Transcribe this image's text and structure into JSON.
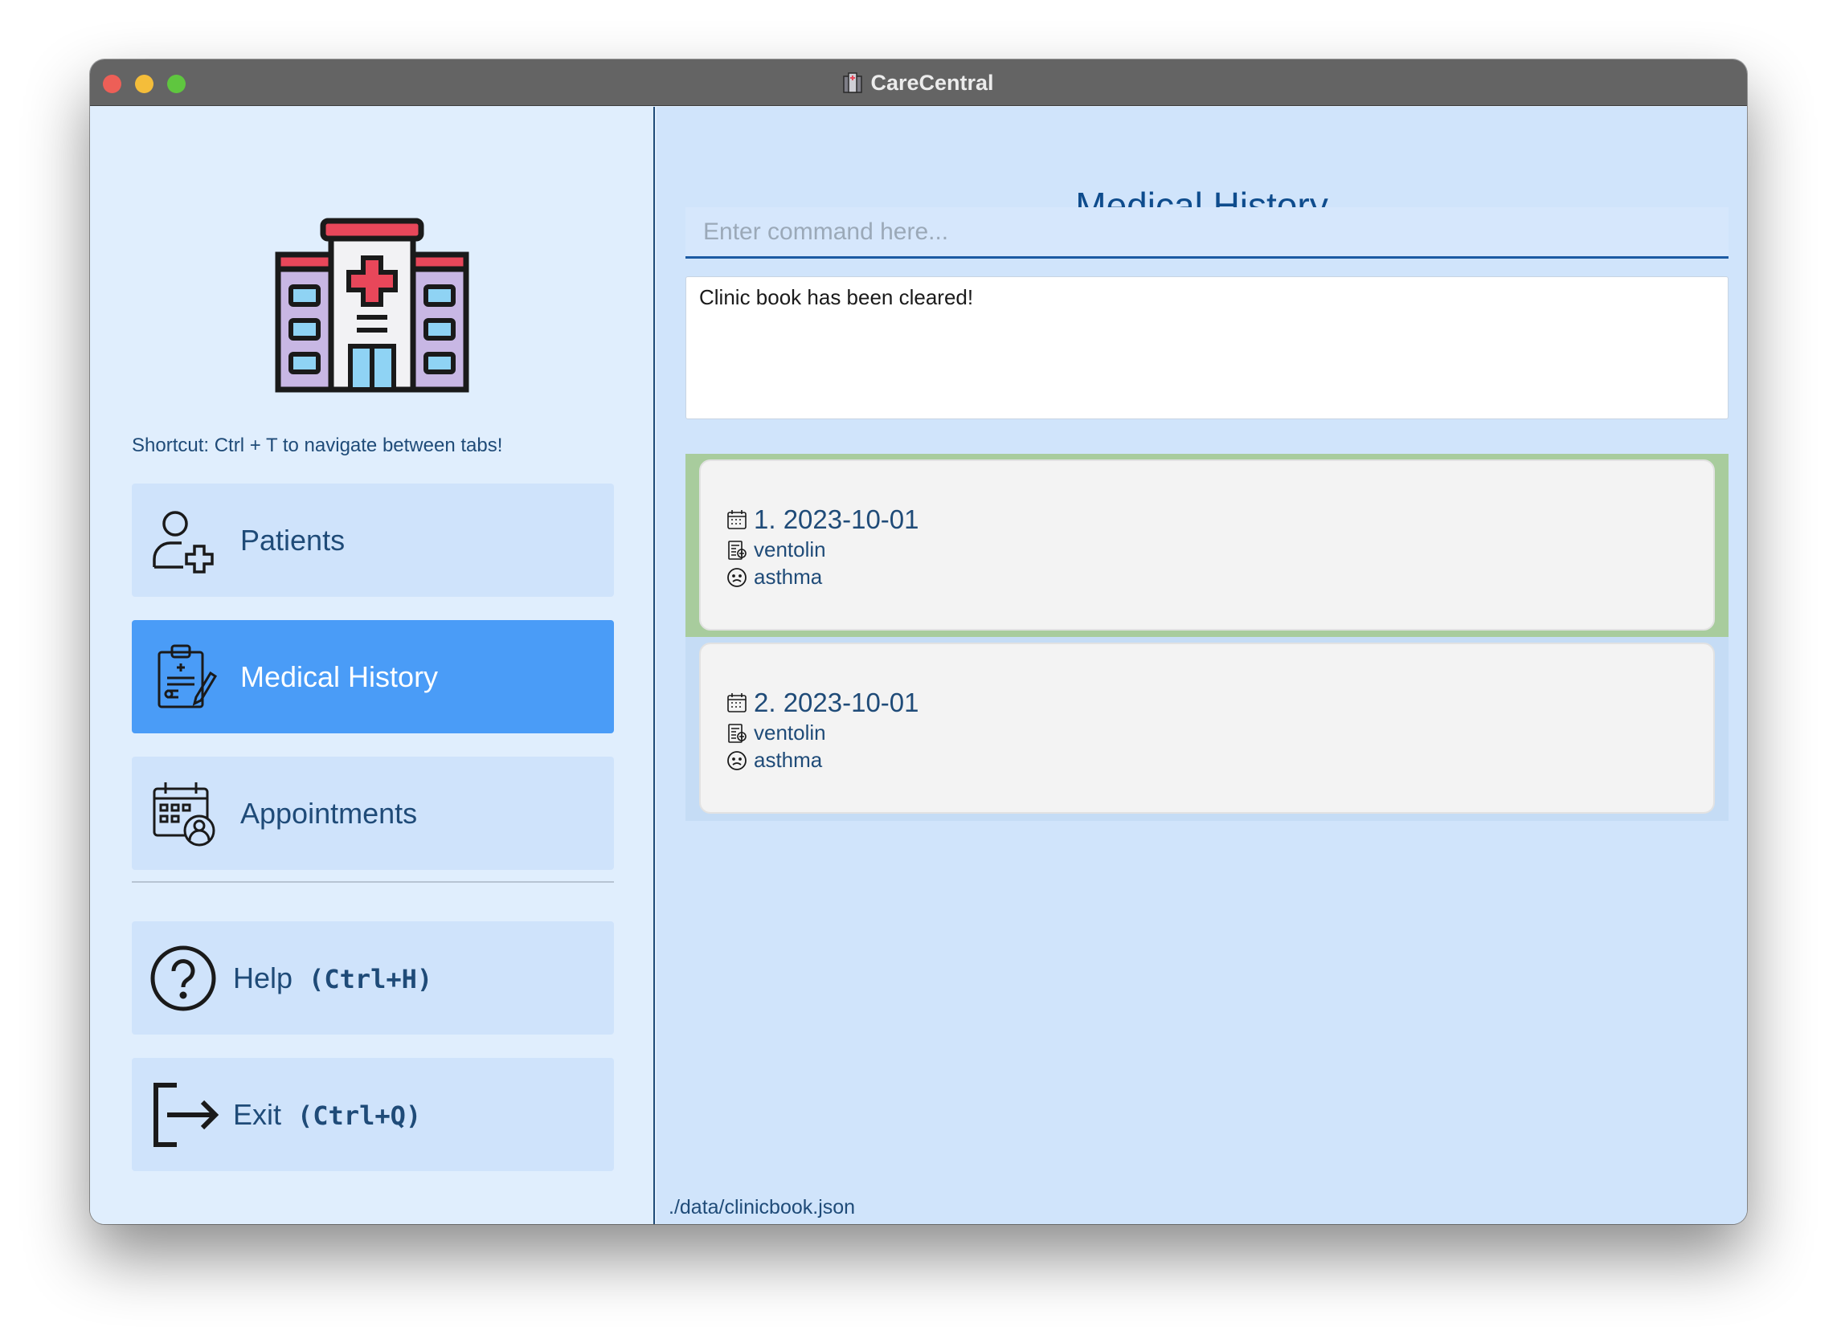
{
  "window": {
    "title": "CareCentral"
  },
  "sidebar": {
    "shortcut_hint": "Shortcut: Ctrl + T to navigate between tabs!",
    "nav": [
      {
        "label": "Patients",
        "icon": "add-user-icon",
        "active": false
      },
      {
        "label": "Medical History",
        "icon": "clipboard-icon",
        "active": true
      },
      {
        "label": "Appointments",
        "icon": "calendar-icon",
        "active": false
      }
    ],
    "help": {
      "label": "Help",
      "shortcut": "(Ctrl+H)",
      "icon": "question-icon"
    },
    "exit": {
      "label": "Exit",
      "shortcut": "(Ctrl+Q)",
      "icon": "exit-icon"
    }
  },
  "main": {
    "title": "Medical History",
    "command": {
      "value": "",
      "placeholder": "Enter command here..."
    },
    "result": "Clinic book has been cleared!",
    "records": [
      {
        "date": "1. 2023-10-01",
        "medication": "ventolin",
        "condition": "asthma",
        "selected": true
      },
      {
        "date": "2. 2023-10-01",
        "medication": "ventolin",
        "condition": "asthma",
        "selected": false
      }
    ]
  },
  "status": {
    "file_path": "./data/clinicbook.json"
  },
  "colors": {
    "accent": "#4a9cf7",
    "text": "#1f4b78",
    "selected_record": "#a8cc9d",
    "logo_red": "#e8475a"
  }
}
